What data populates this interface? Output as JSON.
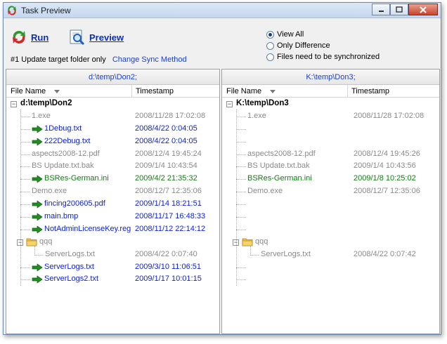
{
  "window": {
    "title": "Task Preview"
  },
  "toolbar": {
    "run_label": "Run",
    "preview_label": "Preview",
    "sync_info": "#1 Update target folder only",
    "change_sync_link": "Change Sync Method"
  },
  "view_options": {
    "selected": "View All",
    "options": [
      "View All",
      "Only Difference",
      "Files need to be synchronized"
    ]
  },
  "left_pane": {
    "header": "d:\\temp\\Don2;",
    "col_name": "File Name",
    "col_time": "Timestamp",
    "root": "d:\\temp\\Don2"
  },
  "right_pane": {
    "header": "K:\\temp\\Don3;",
    "col_name": "File Name",
    "col_time": "Timestamp",
    "root": "K:\\temp\\Don3"
  },
  "left_rows": [
    {
      "name": "1.exe",
      "time": "2008/11/28 17:02:08",
      "style": "gray"
    },
    {
      "name": "1Debug.txt",
      "time": "2008/4/22 0:04:05",
      "style": "blue",
      "icon": "arrow"
    },
    {
      "name": "222Debug.txt",
      "time": "2008/4/22 0:04:05",
      "style": "blue",
      "icon": "arrow"
    },
    {
      "name": "aspects2008-12.pdf",
      "time": "2008/12/4 19:45:24",
      "style": "gray"
    },
    {
      "name": "BS Update.txt.bak",
      "time": "2009/1/4 10:43:54",
      "style": "gray"
    },
    {
      "name": "BSRes-German.ini",
      "time": "2009/4/2 21:35:32",
      "style": "green",
      "icon": "arrow"
    },
    {
      "name": "Demo.exe",
      "time": "2008/12/7 12:35:06",
      "style": "gray"
    },
    {
      "name": "fincing200605.pdf",
      "time": "2009/1/14 18:21:51",
      "style": "blue",
      "icon": "arrow"
    },
    {
      "name": "main.bmp",
      "time": "2008/11/17 16:48:33",
      "style": "blue",
      "icon": "arrow"
    },
    {
      "name": "NotAdminLicenseKey.reg",
      "time": "2008/11/12 22:14:12",
      "style": "blue",
      "icon": "arrow"
    },
    {
      "name": "qqq",
      "time": "",
      "style": "gray",
      "icon": "folder"
    },
    {
      "name": "ServerLogs.txt",
      "time": "2008/4/22 0:07:40",
      "style": "gray",
      "child": true
    },
    {
      "name": "ServerLogs.txt",
      "time": "2009/3/10 11:06:51",
      "style": "blue",
      "icon": "arrow"
    },
    {
      "name": "ServerLogs2.txt",
      "time": "2009/1/17 10:01:15",
      "style": "blue",
      "icon": "arrow"
    }
  ],
  "right_rows": [
    {
      "name": "1.exe",
      "time": "2008/11/28 17:02:08",
      "style": "gray"
    },
    {
      "name": "",
      "time": "",
      "style": "gray"
    },
    {
      "name": "",
      "time": "",
      "style": "gray"
    },
    {
      "name": "aspects2008-12.pdf",
      "time": "2008/12/4 19:45:26",
      "style": "gray"
    },
    {
      "name": "BS Update.txt.bak",
      "time": "2009/1/4 10:43:56",
      "style": "gray"
    },
    {
      "name": "BSRes-German.ini",
      "time": "2009/1/8 10:25:02",
      "style": "green"
    },
    {
      "name": "Demo.exe",
      "time": "2008/12/7 12:35:06",
      "style": "gray"
    },
    {
      "name": "",
      "time": "",
      "style": "gray"
    },
    {
      "name": "",
      "time": "",
      "style": "gray"
    },
    {
      "name": "",
      "time": "",
      "style": "gray"
    },
    {
      "name": "qqq",
      "time": "",
      "style": "gray",
      "icon": "folder"
    },
    {
      "name": "ServerLogs.txt",
      "time": "2008/4/22 0:07:42",
      "style": "gray",
      "child": true
    },
    {
      "name": "",
      "time": "",
      "style": "gray"
    },
    {
      "name": "",
      "time": "",
      "style": "gray"
    }
  ]
}
